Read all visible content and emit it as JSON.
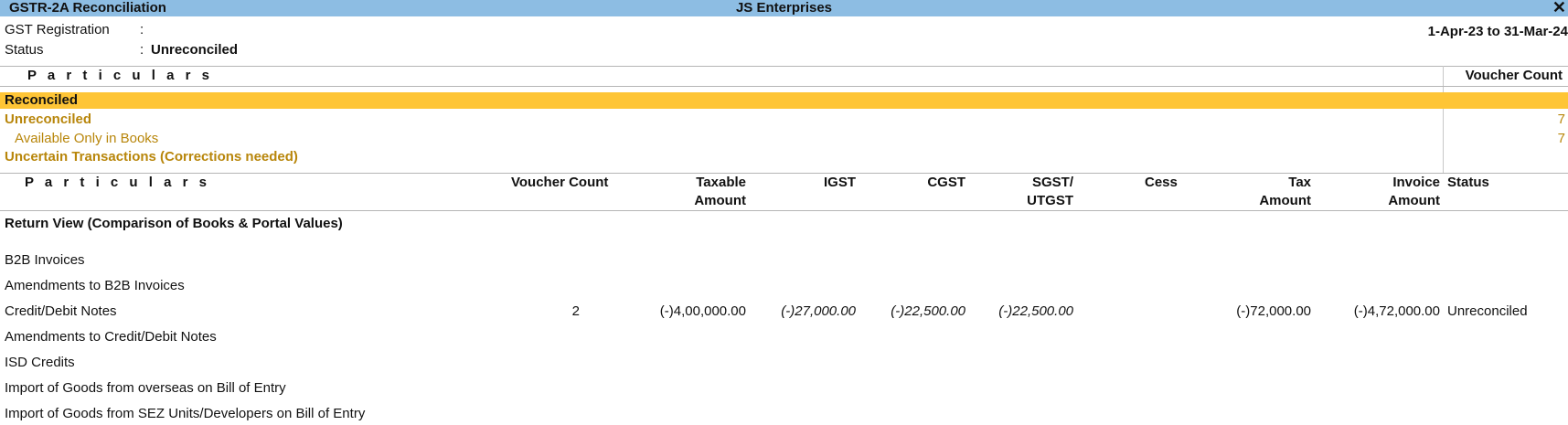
{
  "window": {
    "report_title": "GSTR-2A Reconciliation",
    "company": "JS Enterprises"
  },
  "info": {
    "gst_label": "GST Registration",
    "gst_colon": ":",
    "gst_value": "",
    "status_label": "Status",
    "status_colon": ":",
    "status_value": "Unreconciled",
    "period": "1-Apr-23 to 31-Mar-24"
  },
  "summary": {
    "col_particulars": "P a r t i c u l a r s",
    "col_voucher_count": "Voucher Count",
    "rows": [
      {
        "name": "Reconciled",
        "count": ""
      },
      {
        "name": "Unreconciled",
        "count": "7"
      },
      {
        "name": "Available Only in Books",
        "count": "7"
      },
      {
        "name": "Uncertain Transactions (Corrections needed)",
        "count": ""
      }
    ]
  },
  "detail": {
    "headers": {
      "particulars": "P a r t i c u l a r s",
      "voucher_count": "Voucher Count",
      "taxable_1": "Taxable",
      "taxable_2": "Amount",
      "igst": "IGST",
      "cgst": "CGST",
      "sgst_1": "SGST/",
      "sgst_2": "UTGST",
      "cess": "Cess",
      "tax_1": "Tax",
      "tax_2": "Amount",
      "invoice_1": "Invoice",
      "invoice_2": "Amount",
      "status": "Status"
    },
    "section_title": "Return View (Comparison of Books & Portal Values)",
    "rows": [
      {
        "name": "B2B Invoices"
      },
      {
        "name": "Amendments to B2B Invoices"
      },
      {
        "name": "Credit/Debit Notes",
        "voucher_count": "2",
        "taxable": "(-)4,00,000.00",
        "igst": "(-)27,000.00",
        "cgst": "(-)22,500.00",
        "sgst": "(-)22,500.00",
        "cess": "",
        "tax": "(-)72,000.00",
        "invoice": "(-)4,72,000.00",
        "status": "Unreconciled"
      },
      {
        "name": "Amendments to Credit/Debit Notes"
      },
      {
        "name": "ISD Credits"
      },
      {
        "name": "Import of Goods from overseas on Bill of Entry"
      },
      {
        "name": "Import of Goods from SEZ Units/Developers on Bill of Entry"
      }
    ]
  },
  "colors": {
    "title_bar": "#8dbde3",
    "selected_row": "#fec536",
    "amber_text": "#b8860b"
  }
}
